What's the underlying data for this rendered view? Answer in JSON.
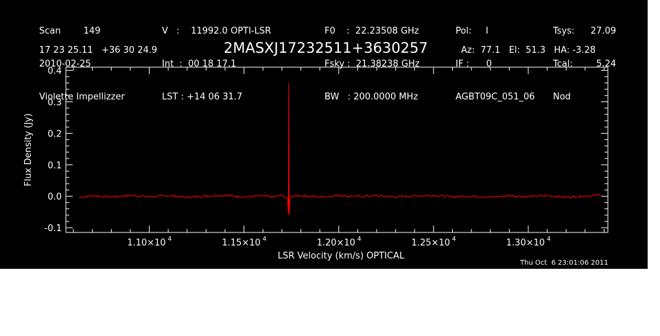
{
  "header": {
    "col1": [
      "Scan        149",
      "2010-02-25",
      "Violette Impellizzer"
    ],
    "col2": [
      "V   :    11992.0 OPTI-LSR",
      "Int  :  00 18 17.1",
      "LST : +14 06 31.7"
    ],
    "col3": [
      "F0    :  22.23508 GHz",
      "Fsky :  21.38238 GHz",
      "BW   : 200.0000 MHz"
    ],
    "col4": [
      "Pol:     I",
      "IF :      0",
      "AGBT09C_051_06"
    ],
    "col5_labels": [
      "Tsys:",
      "Tcal:",
      "Nod"
    ],
    "col5_values": [
      "27.09",
      "5.24",
      ""
    ],
    "coords": "17 23 25.11   +36 30 24.9",
    "source": "2MASXJ17232511+3630257",
    "azel": "Az:  77.1   El:  51.3   HA: -3.28",
    "timestamp": "Thu Oct  6 23:01:06 2011"
  },
  "colors": {
    "background": "#000000",
    "axes": "#ffffff",
    "trace": "#ff0000"
  },
  "chart_data": {
    "type": "line",
    "xlabel": "LSR Velocity (km/s) OPTICAL",
    "ylabel": "Flux Density (Jy)",
    "xlim": [
      10560,
      13420
    ],
    "ylim": [
      -0.115,
      0.41
    ],
    "x_ticks": [
      11000,
      11500,
      12000,
      12500,
      13000
    ],
    "x_tick_labels": [
      "1.10×10",
      "1.15×10",
      "1.20×10",
      "1.25×10",
      "1.30×10"
    ],
    "x_tick_exponent": "4",
    "y_ticks": [
      -0.1,
      0.0,
      0.1,
      0.2,
      0.3,
      0.4
    ],
    "y_tick_labels": [
      "-0.1",
      "0.0",
      "0.1",
      "0.2",
      "0.3",
      "0.4"
    ],
    "grid": false,
    "series": [
      {
        "x": [
          10630,
          10700,
          10800,
          10900,
          11000,
          11100,
          11200,
          11300,
          11400,
          11500,
          11600,
          11650,
          11700,
          11720,
          11730,
          11734,
          11736,
          11738,
          11742,
          11750,
          11800,
          11900,
          12000,
          12100,
          12200,
          12300,
          12400,
          12500,
          12600,
          12700,
          12800,
          12900,
          13000,
          13100,
          13200,
          13300,
          13380
        ],
        "y": [
          -0.004,
          0.002,
          -0.002,
          0.003,
          -0.001,
          0.002,
          -0.003,
          0.001,
          0.003,
          -0.002,
          0.001,
          -0.002,
          0.002,
          -0.004,
          -0.008,
          -0.055,
          0.36,
          -0.06,
          -0.01,
          0.0,
          0.002,
          -0.002,
          0.003,
          -0.001,
          0.002,
          -0.002,
          0.001,
          0.003,
          -0.002,
          0.001,
          -0.003,
          0.002,
          -0.001,
          0.002,
          -0.003,
          0.001,
          0.004
        ]
      }
    ]
  }
}
